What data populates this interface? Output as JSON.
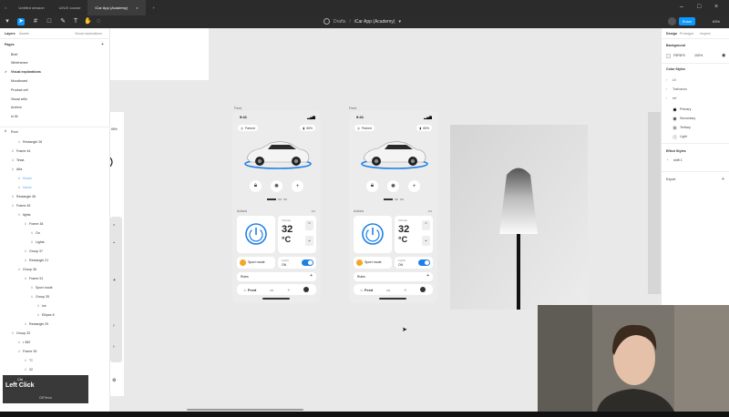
{
  "browser": {
    "tabs": [
      {
        "label": "Untitled session"
      },
      {
        "label": "UI/UX course"
      },
      {
        "label": "iCar App (Academy)"
      }
    ],
    "new_tab": "+"
  },
  "toolbar": {
    "file_team": "Drafts",
    "separator": "/",
    "file_name": "iCar App (Academy)",
    "share_label": "Share",
    "zoom": "63%"
  },
  "left_panel": {
    "tabs": [
      "Layers",
      "Assets"
    ],
    "page_context": "Visual explorations",
    "pages_title": "Pages",
    "pages": [
      "Brief",
      "Wireframes",
      "Visual explorations",
      "Moodboard",
      "Product cell",
      "Visual cells",
      "Archive",
      "In fill"
    ],
    "active_page": "Visual explorations",
    "layers_title": "Root",
    "layers": [
      {
        "label": "Rectangle 28",
        "indent": 2
      },
      {
        "label": "Frame 44",
        "indent": 1
      },
      {
        "label": "Tesla",
        "indent": 1
      },
      {
        "label": "Alfa",
        "indent": 1
      },
      {
        "label": "Model",
        "indent": 2,
        "muted": true
      },
      {
        "label": "Name",
        "indent": 2,
        "muted": true
      },
      {
        "label": "Rectangle 36",
        "indent": 1
      },
      {
        "label": "Frame 45",
        "indent": 1
      },
      {
        "label": "lights",
        "indent": 2
      },
      {
        "label": "Frame 38",
        "indent": 3
      },
      {
        "label": "On",
        "indent": 4
      },
      {
        "label": "Lights",
        "indent": 4
      },
      {
        "label": "Group 37",
        "indent": 3
      },
      {
        "label": "Rectangle 21",
        "indent": 3
      },
      {
        "label": "Group 36",
        "indent": 2
      },
      {
        "label": "Frame 51",
        "indent": 3
      },
      {
        "label": "Sport mode",
        "indent": 4
      },
      {
        "label": "Group 35",
        "indent": 4
      },
      {
        "label": "Ice",
        "indent": 5
      },
      {
        "label": "Ellipse 8",
        "indent": 5
      },
      {
        "label": "Rectangle 29",
        "indent": 3
      },
      {
        "label": "Group 33",
        "indent": 1
      },
      {
        "label": "• 360",
        "indent": 2
      },
      {
        "label": "Frame 35",
        "indent": 2
      },
      {
        "label": "°C",
        "indent": 3
      },
      {
        "label": "32",
        "indent": 3
      },
      {
        "label": "Group 44",
        "indent": 1
      }
    ]
  },
  "right_panel": {
    "tabs": [
      "Design",
      "Prototype",
      "Inspect"
    ],
    "background_title": "Background",
    "background_hex": "F5F5F5",
    "background_opacity": "100%",
    "color_styles_title": "Color Styles",
    "color_groups": [
      "UI",
      "Trafcarolo",
      "ref"
    ],
    "colors": [
      {
        "name": "Primary",
        "hex": "#111111"
      },
      {
        "name": "Secondary",
        "hex": "#555555"
      },
      {
        "name": "Tertiary",
        "hex": "#9a9a9a"
      },
      {
        "name": "Light",
        "hex": "#e3e3e3"
      }
    ],
    "effect_styles_title": "Effect Styles",
    "effects": [
      "shift 1"
    ],
    "export_title": "Export"
  },
  "canvas": {
    "frame_label_1": "Feed",
    "frame_label_2": "Feed",
    "phones": [
      {
        "time": "9:41",
        "signal": "▂▄▆",
        "model_chip": "Parked",
        "battery_chip": "65%",
        "section_label": "Actions",
        "temp_label": "Climate",
        "temp_value": "32",
        "temp_unit": "°C",
        "sport_mode": "Sport mode",
        "lights_label": "Lights",
        "lights_value": "ON",
        "quick_label": "Rules",
        "nav_feed": "Feed"
      },
      {
        "time": "9:41",
        "signal": "▂▄▆",
        "model_chip": "Parked",
        "battery_chip": "65%",
        "section_label": "Actions",
        "temp_label": "Climate",
        "temp_value": "32",
        "temp_unit": "°C",
        "sport_mode": "Sport mode",
        "lights_label": "Lights",
        "lights_value": "ON",
        "quick_label": "Rules",
        "nav_feed": "Feed"
      }
    ],
    "left_frame_chip": "65%"
  },
  "overlay": {
    "shortcut_key": "Ctrl",
    "action": "Left Click",
    "detail": "GIFlecs"
  },
  "colors": {
    "accent": "#0d99ff",
    "toggle_blue": "#1e80e6"
  }
}
